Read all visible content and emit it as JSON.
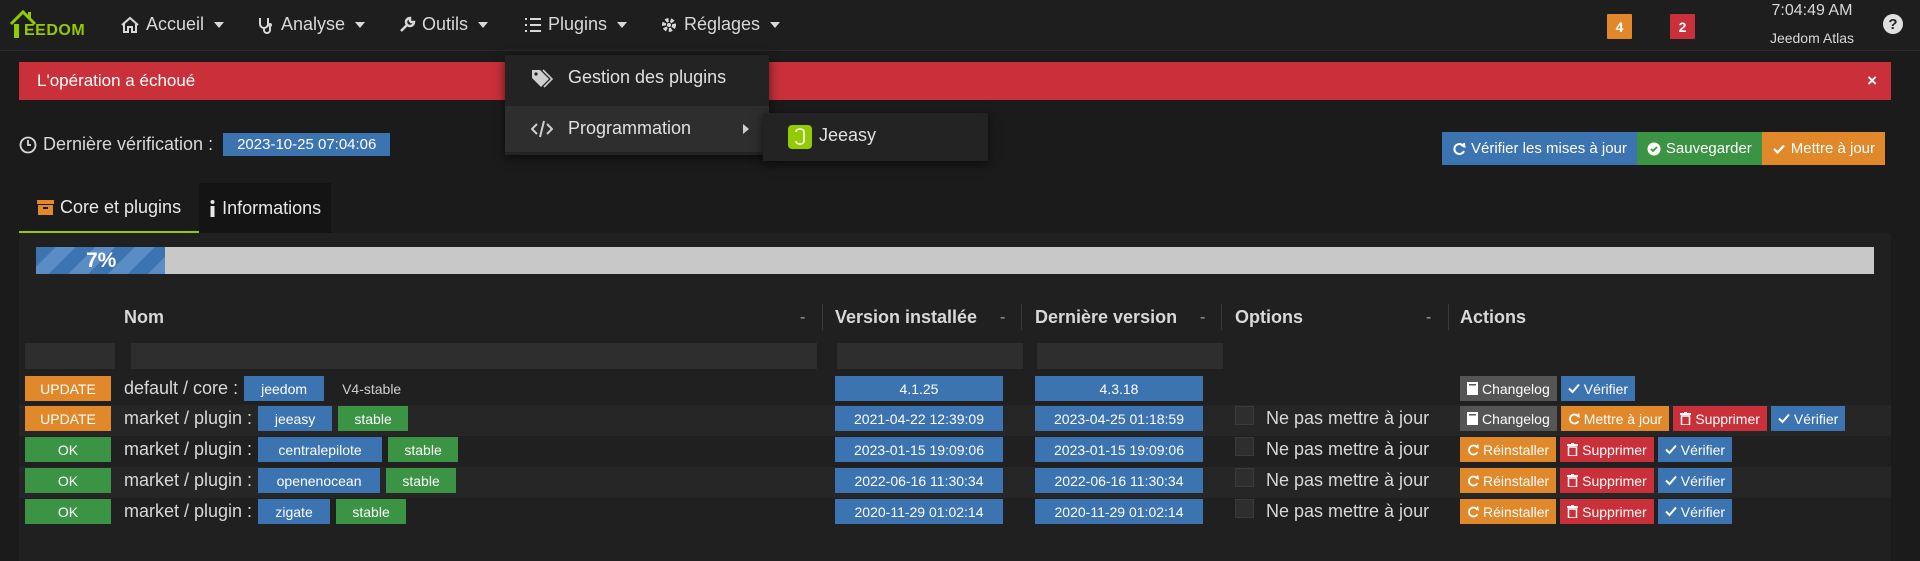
{
  "nav": {
    "logo_text": "EEDOM",
    "items": [
      {
        "label": "Accueil"
      },
      {
        "label": "Analyse"
      },
      {
        "label": "Outils"
      },
      {
        "label": "Plugins"
      },
      {
        "label": "Réglages"
      }
    ],
    "badge_warning": "4",
    "badge_alert": "2",
    "clock": "7:04:49 AM",
    "host": "Jeedom Atlas",
    "help": "?"
  },
  "alert": {
    "message": "L'opération a échoué",
    "close": "×"
  },
  "plugins_menu": {
    "items": [
      {
        "label": "Gestion des plugins",
        "icon": "tags-icon"
      },
      {
        "label": "Programmation",
        "icon": "code-icon"
      }
    ],
    "submenu": [
      {
        "label": "Jeeasy"
      }
    ]
  },
  "last_check": {
    "label": "Dernière vérification :",
    "value": "2023-10-25 07:04:06"
  },
  "top_actions": {
    "check_updates": "Vérifier les mises à jour",
    "save": "Sauvegarder",
    "update": "Mettre à jour"
  },
  "tabs": [
    {
      "label": "Core et plugins"
    },
    {
      "label": "Informations"
    }
  ],
  "progress": {
    "percent": 7,
    "label": "7%"
  },
  "table": {
    "headers": {
      "name": "Nom",
      "installed": "Version installée",
      "latest": "Dernière version",
      "options": "Options",
      "actions": "Actions",
      "sort": "-"
    },
    "rows": [
      {
        "status": "UPDATE",
        "prefix": "default / core :",
        "name": "jeedom",
        "branch": "V4-stable",
        "installed": "4.1.25",
        "latest": "4.3.18",
        "option": "",
        "actions": [
          {
            "label": "Changelog",
            "kind": "grey"
          },
          {
            "label": "Vérifier",
            "kind": "blue"
          }
        ]
      },
      {
        "status": "UPDATE",
        "prefix": "market / plugin :",
        "name": "jeeasy",
        "branch": "stable",
        "installed": "2021-04-22 12:39:09",
        "latest": "2023-04-25 01:18:59",
        "option": "Ne pas mettre à jour",
        "actions": [
          {
            "label": "Changelog",
            "kind": "grey"
          },
          {
            "label": "Mettre à jour",
            "kind": "orange"
          },
          {
            "label": "Supprimer",
            "kind": "red"
          },
          {
            "label": "Vérifier",
            "kind": "blue"
          }
        ]
      },
      {
        "status": "OK",
        "prefix": "market / plugin :",
        "name": "centralepilote",
        "branch": "stable",
        "installed": "2023-01-15 19:09:06",
        "latest": "2023-01-15 19:09:06",
        "option": "Ne pas mettre à jour",
        "actions": [
          {
            "label": "Réinstaller",
            "kind": "orange"
          },
          {
            "label": "Supprimer",
            "kind": "red"
          },
          {
            "label": "Vérifier",
            "kind": "blue"
          }
        ]
      },
      {
        "status": "OK",
        "prefix": "market / plugin :",
        "name": "openenocean",
        "branch": "stable",
        "installed": "2022-06-16 11:30:34",
        "latest": "2022-06-16 11:30:34",
        "option": "Ne pas mettre à jour",
        "actions": [
          {
            "label": "Réinstaller",
            "kind": "orange"
          },
          {
            "label": "Supprimer",
            "kind": "red"
          },
          {
            "label": "Vérifier",
            "kind": "blue"
          }
        ]
      },
      {
        "status": "OK",
        "prefix": "market / plugin :",
        "name": "zigate",
        "branch": "stable",
        "installed": "2020-11-29 01:02:14",
        "latest": "2020-11-29 01:02:14",
        "option": "Ne pas mettre à jour",
        "actions": [
          {
            "label": "Réinstaller",
            "kind": "orange"
          },
          {
            "label": "Supprimer",
            "kind": "red"
          },
          {
            "label": "Vérifier",
            "kind": "blue"
          }
        ]
      }
    ]
  },
  "colors": {
    "accent": "#94ca02",
    "blue": "#3c73b1",
    "green": "#3b9444",
    "orange": "#e0882a",
    "red": "#c9303a"
  }
}
